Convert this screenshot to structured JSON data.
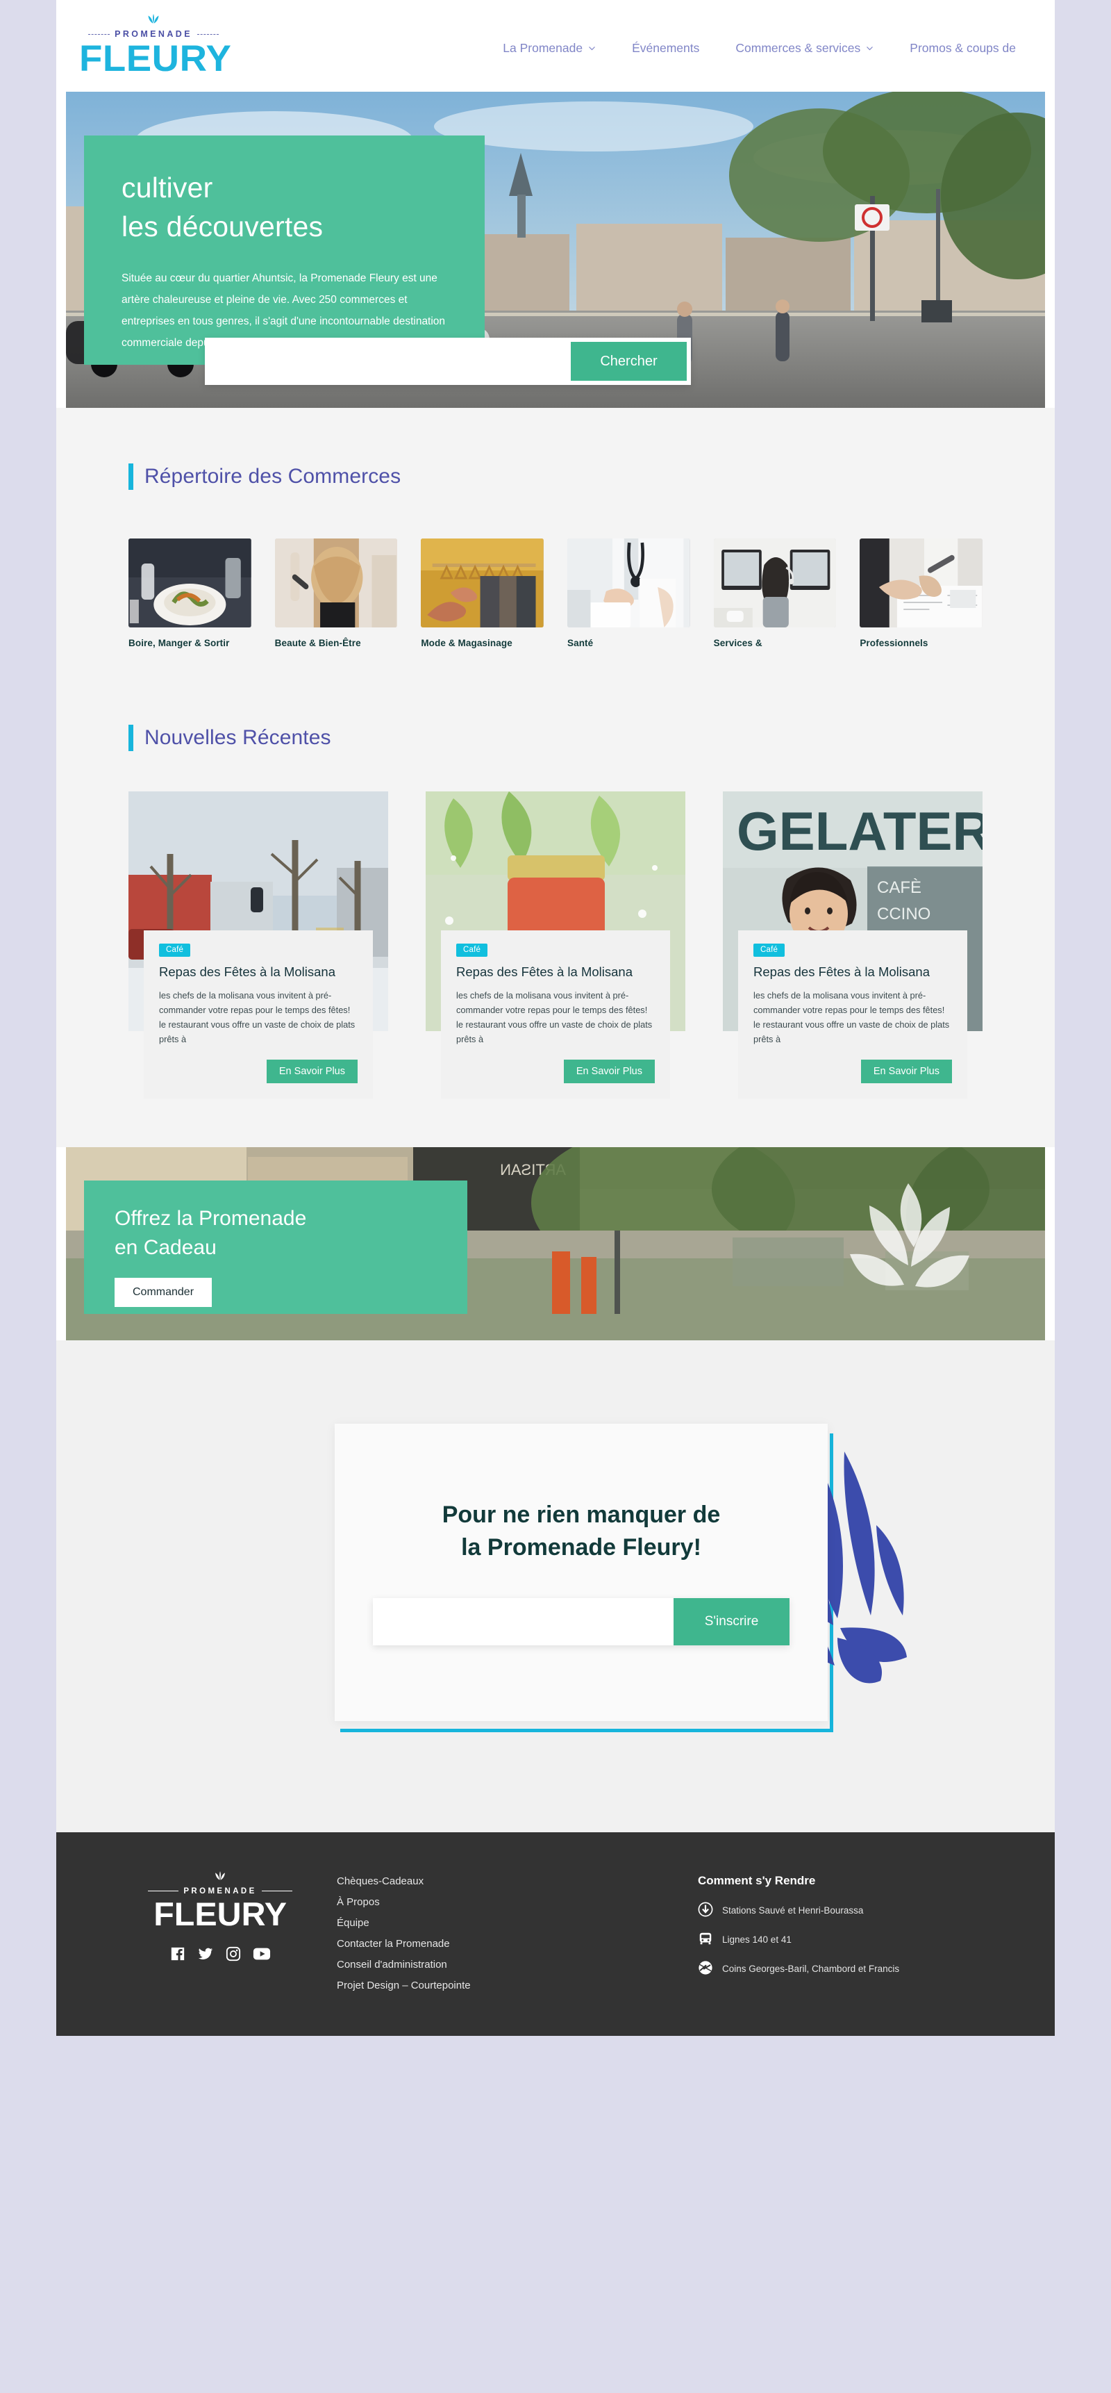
{
  "brand": {
    "logo_top": "PROMENADE",
    "logo_main": "FLEURY",
    "accent_green": "#3fb68e",
    "accent_cyan": "#17b5dc",
    "accent_purple": "#4f51a8",
    "hero_green": "#4fc09b",
    "leaf_blue": "#3c4cac",
    "footer_bg": "#333333"
  },
  "nav": {
    "items": [
      {
        "label": "La Promenade",
        "has_caret": true
      },
      {
        "label": "Événements",
        "has_caret": false
      },
      {
        "label": "Commerces & services",
        "has_caret": true
      },
      {
        "label": "Promos & coups de",
        "has_caret": false
      }
    ]
  },
  "hero": {
    "title_line1": "cultiver",
    "title_line2": "les découvertes",
    "paragraph": "Située au cœur du quartier Ahuntsic, la Promenade Fleury est une artère chaleureuse et pleine de vie. Avec 250 commerces et entreprises en tous genres, il s'agit d'une incontournable destination commerciale depuis",
    "search_value": "",
    "search_placeholder": "",
    "search_button": "Chercher"
  },
  "directory": {
    "title": "Répertoire des Commerces",
    "categories": [
      {
        "label": "Boire, Manger & Sortir",
        "icon": "restaurant-photo"
      },
      {
        "label": "Beaute & Bien-Être",
        "icon": "salon-photo"
      },
      {
        "label": "Mode & Magasinage",
        "icon": "clothing-rack-photo"
      },
      {
        "label": "Santé",
        "icon": "doctor-photo"
      },
      {
        "label": "Services &",
        "icon": "office-worker-photo"
      },
      {
        "label": "Professionnels",
        "icon": "meeting-photo"
      }
    ]
  },
  "news": {
    "title": "Nouvelles Récentes",
    "cards": [
      {
        "badge": "Café",
        "title": "Repas des Fêtes à la Molisana",
        "excerpt": "les chefs de la molisana vous invitent à pré-commander votre repas pour le temps des fêtes! le restaurant vous offre un vaste de choix de plats prêts à",
        "cta": "En Savoir Plus",
        "image": "winter-street-photo"
      },
      {
        "badge": "Café",
        "title": "Repas des Fêtes à la Molisana",
        "excerpt": "les chefs de la molisana vous invitent à pré-commander votre repas pour le temps des fêtes! le restaurant vous offre un vaste de choix de plats prêts à",
        "cta": "En Savoir Plus",
        "image": "sauce-jar-photo"
      },
      {
        "badge": "Café",
        "title": "Repas des Fêtes à la Molisana",
        "excerpt": "les chefs de la molisana vous invitent à pré-commander votre repas pour le temps des fêtes! le restaurant vous offre un vaste de choix de plats prêts à",
        "cta": "En Savoir Plus",
        "image": "gelateria-owner-photo"
      }
    ]
  },
  "gift": {
    "title_line1": "Offrez la Promenade",
    "title_line2": "en Cadeau",
    "button": "Commander"
  },
  "newsletter": {
    "title_line1": "Pour ne rien manquer de",
    "title_line2": "la Promenade Fleury!",
    "email_value": "",
    "email_placeholder": "",
    "button": "S'inscrire"
  },
  "footer": {
    "links": [
      "Chèques-Cadeaux",
      "À Propos",
      "Équipe",
      "Contacter la Promenade",
      "Conseil d'administration",
      "Projet Design – Courtepointe"
    ],
    "socials": [
      {
        "name": "facebook-icon"
      },
      {
        "name": "twitter-icon"
      },
      {
        "name": "instagram-icon"
      },
      {
        "name": "youtube-icon"
      }
    ],
    "transit_title": "Comment s'y Rendre",
    "transit": [
      {
        "icon": "metro-icon",
        "text": "Stations Sauvé et Henri-Bourassa"
      },
      {
        "icon": "bus-icon",
        "text": "Lignes 140 et 41"
      },
      {
        "icon": "bixi-bike-icon",
        "text": "Coins Georges-Baril, Chambord et Francis"
      }
    ]
  }
}
